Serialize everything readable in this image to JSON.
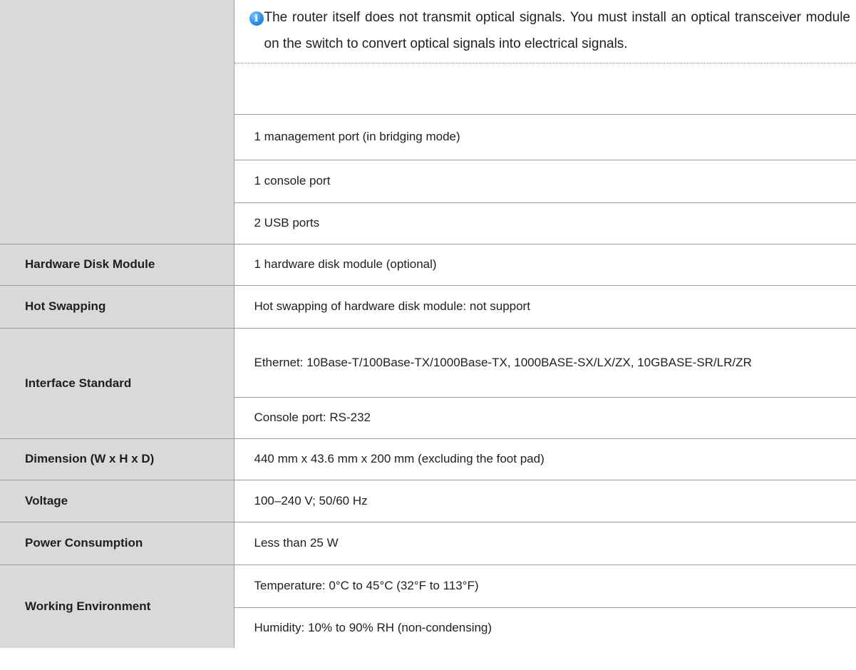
{
  "note": {
    "icon": "info-icon",
    "text": "The router itself does not transmit optical signals. You must install an optical transceiver module on the switch to convert optical signals into electrical signals."
  },
  "rows": {
    "ports": {
      "label": "",
      "values": [
        "1 management port (in bridging mode)",
        "1 console port",
        "2 USB ports"
      ]
    },
    "hardware_disk": {
      "label": "Hardware Disk Module",
      "value": "1 hardware disk module (optional)"
    },
    "hot_swapping": {
      "label": "Hot Swapping",
      "value": "Hot swapping of hardware disk module: not support"
    },
    "interface_standard": {
      "label": "Interface Standard",
      "values": [
        "Ethernet: 10Base-T/100Base-TX/1000Base-TX, 1000BASE-SX/LX/ZX, 10GBASE-SR/LR/ZR",
        "Console port: RS-232"
      ]
    },
    "dimension": {
      "label": "Dimension (W x H x D)",
      "value": "440 mm x 43.6 mm x 200 mm (excluding the foot pad)"
    },
    "voltage": {
      "label": "Voltage",
      "value": "100–240 V; 50/60 Hz"
    },
    "power": {
      "label": "Power Consumption",
      "value": "Less than 25 W"
    },
    "environment": {
      "label": "Working Environment",
      "values": [
        "Temperature: 0°C to 45°C (32°F to 113°F)",
        "Humidity: 10% to 90% RH (non-condensing)"
      ]
    }
  }
}
